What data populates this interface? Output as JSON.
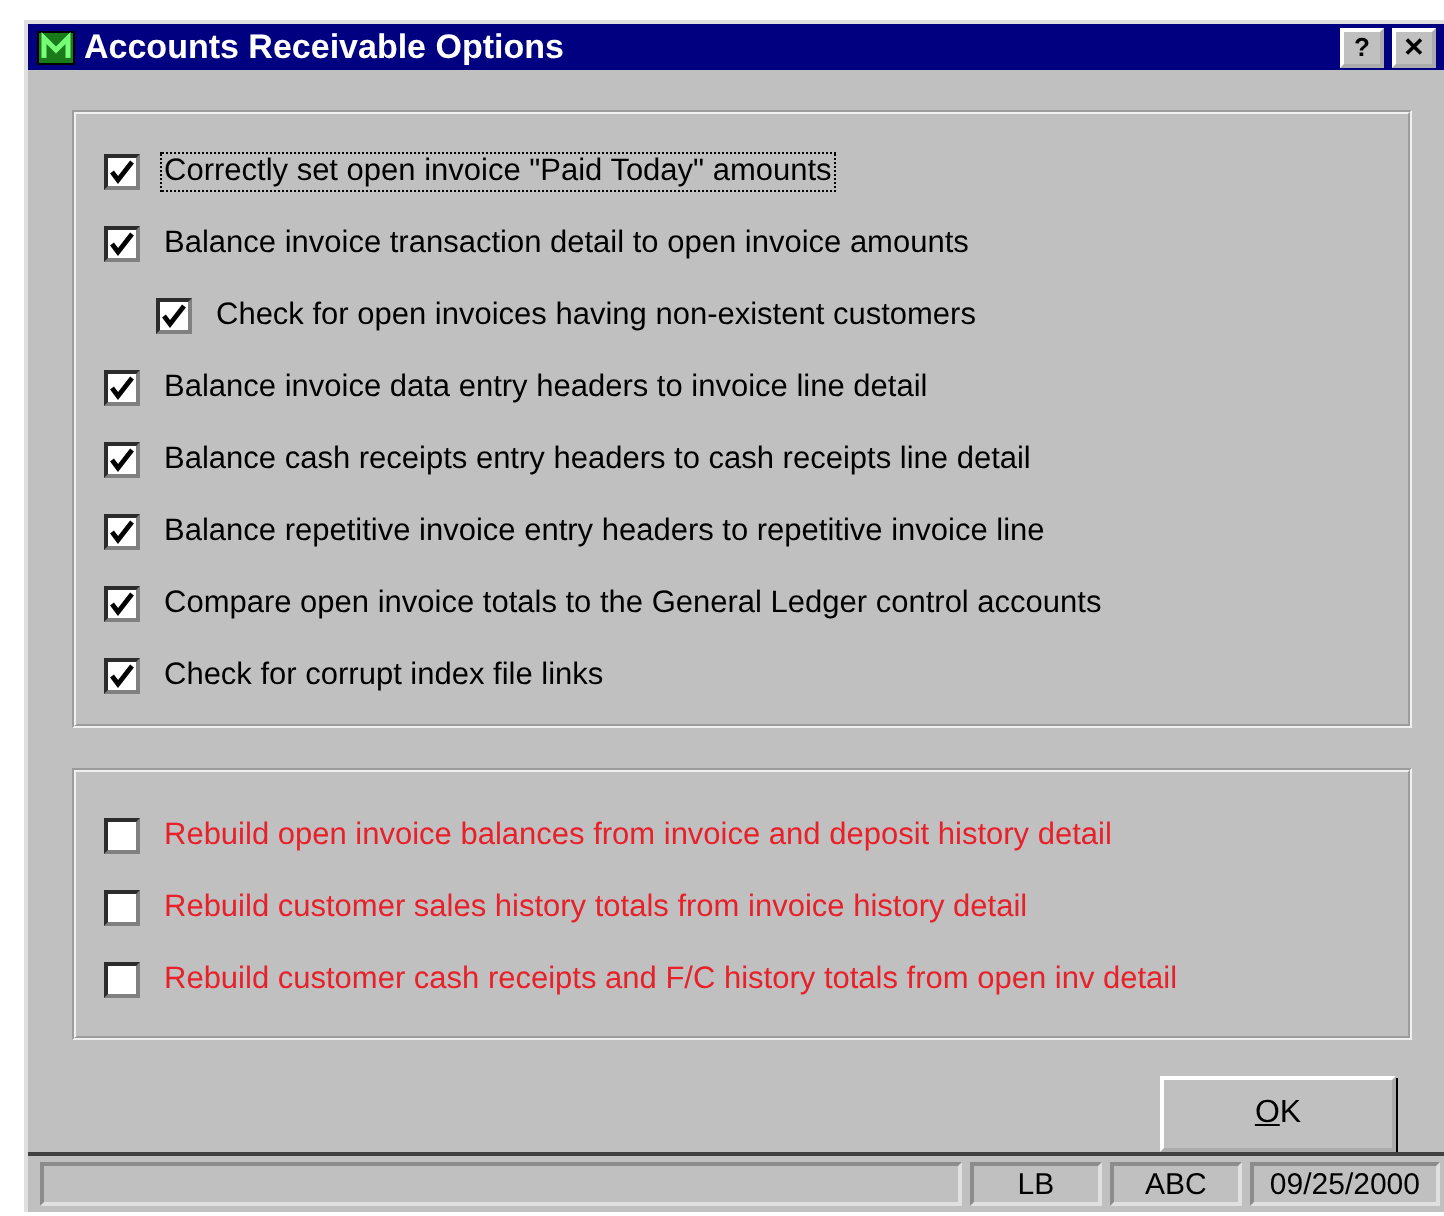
{
  "window": {
    "title": "Accounts Receivable Options",
    "buttons": [
      "?",
      "✕"
    ]
  },
  "checks": [
    {
      "label": "Correctly set open invoice \"Paid Today\" amounts",
      "checked": true,
      "focused": true
    },
    {
      "label": "Balance invoice transaction detail to open invoice amounts",
      "checked": true,
      "focused": false,
      "children": [
        {
          "label": "Check for open invoices having non-existent customers",
          "checked": true,
          "focused": false
        }
      ]
    },
    {
      "label": "Balance invoice data entry headers to invoice line detail",
      "checked": true,
      "focused": false
    },
    {
      "label": "Balance cash receipts entry headers to cash receipts line detail",
      "checked": true,
      "focused": false
    },
    {
      "label": "Balance repetitive invoice entry headers to repetitive invoice line",
      "checked": true,
      "focused": false
    },
    {
      "label": "Compare open invoice totals to the General Ledger control accounts",
      "checked": true,
      "focused": false
    },
    {
      "label": "Check for corrupt index file links",
      "checked": true,
      "focused": false
    }
  ],
  "rebuild": [
    {
      "label": "Rebuild open invoice balances from invoice and deposit history detail",
      "checked": false,
      "color": "#e8202a"
    },
    {
      "label": "Rebuild customer sales history totals from invoice history detail",
      "checked": false,
      "color": "#e8202a"
    },
    {
      "label": "Rebuild customer cash receipts and F/C history totals from open inv detail",
      "checked": false,
      "color": "#e8202a"
    }
  ],
  "ok_button": "OK",
  "status_bar": [
    "LB",
    "ABC",
    "09/25/2000"
  ]
}
